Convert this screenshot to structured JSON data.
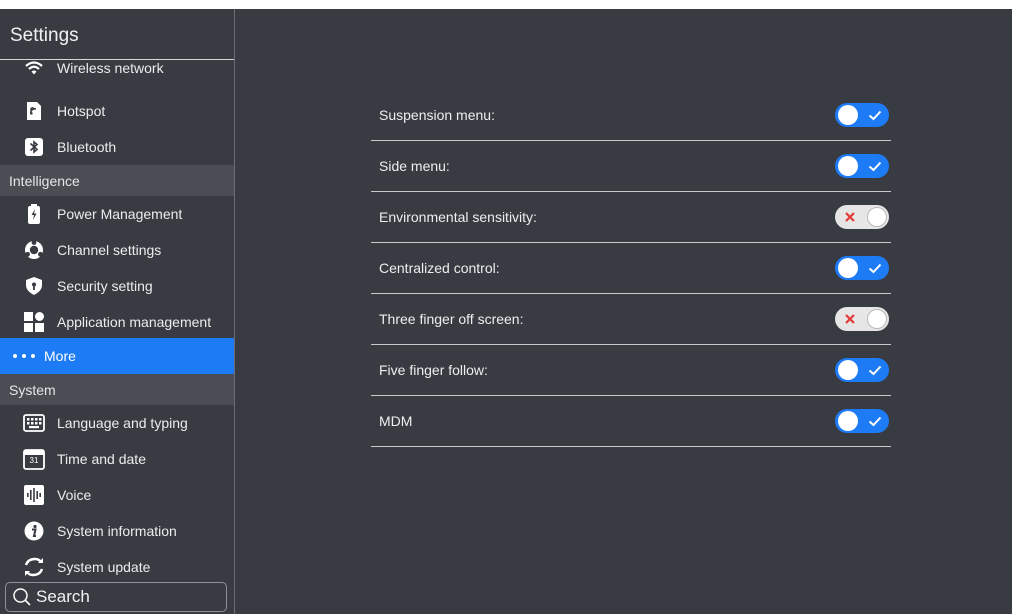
{
  "sidebar": {
    "title": "Settings",
    "items": [
      {
        "label": "Wireless network",
        "icon": "wifi-icon"
      },
      {
        "label": "Hotspot",
        "icon": "hotspot-icon"
      },
      {
        "label": "Bluetooth",
        "icon": "bluetooth-icon"
      },
      {
        "label": "Power Management",
        "icon": "battery-icon"
      },
      {
        "label": "Channel settings",
        "icon": "channel-icon"
      },
      {
        "label": "Security setting",
        "icon": "shield-icon"
      },
      {
        "label": "Application management",
        "icon": "apps-grid-icon"
      },
      {
        "label": "More",
        "icon": "more-dots-icon",
        "active": true
      },
      {
        "label": "Language and typing",
        "icon": "keyboard-icon"
      },
      {
        "label": "Time and date",
        "icon": "calendar-icon",
        "icon_text": "31"
      },
      {
        "label": "Voice",
        "icon": "voice-icon"
      },
      {
        "label": "System information",
        "icon": "info-icon"
      },
      {
        "label": "System update",
        "icon": "refresh-icon"
      }
    ],
    "section_headers": [
      "Intelligence",
      "System"
    ],
    "search_label": "Search"
  },
  "settings": {
    "rows": [
      {
        "label": "Suspension menu:",
        "on": true
      },
      {
        "label": "Side menu:",
        "on": true
      },
      {
        "label": "Environmental sensitivity:",
        "on": false
      },
      {
        "label": "Centralized control:",
        "on": true
      },
      {
        "label": "Three finger off screen:",
        "on": false
      },
      {
        "label": "Five finger follow:",
        "on": true
      },
      {
        "label": "MDM",
        "on": true
      }
    ]
  },
  "colors": {
    "background": "#383b42",
    "accent": "#1e7bf6",
    "section_header": "#4a4d54",
    "toggle_off": "#e6e6e6",
    "off_mark": "#e53935"
  }
}
